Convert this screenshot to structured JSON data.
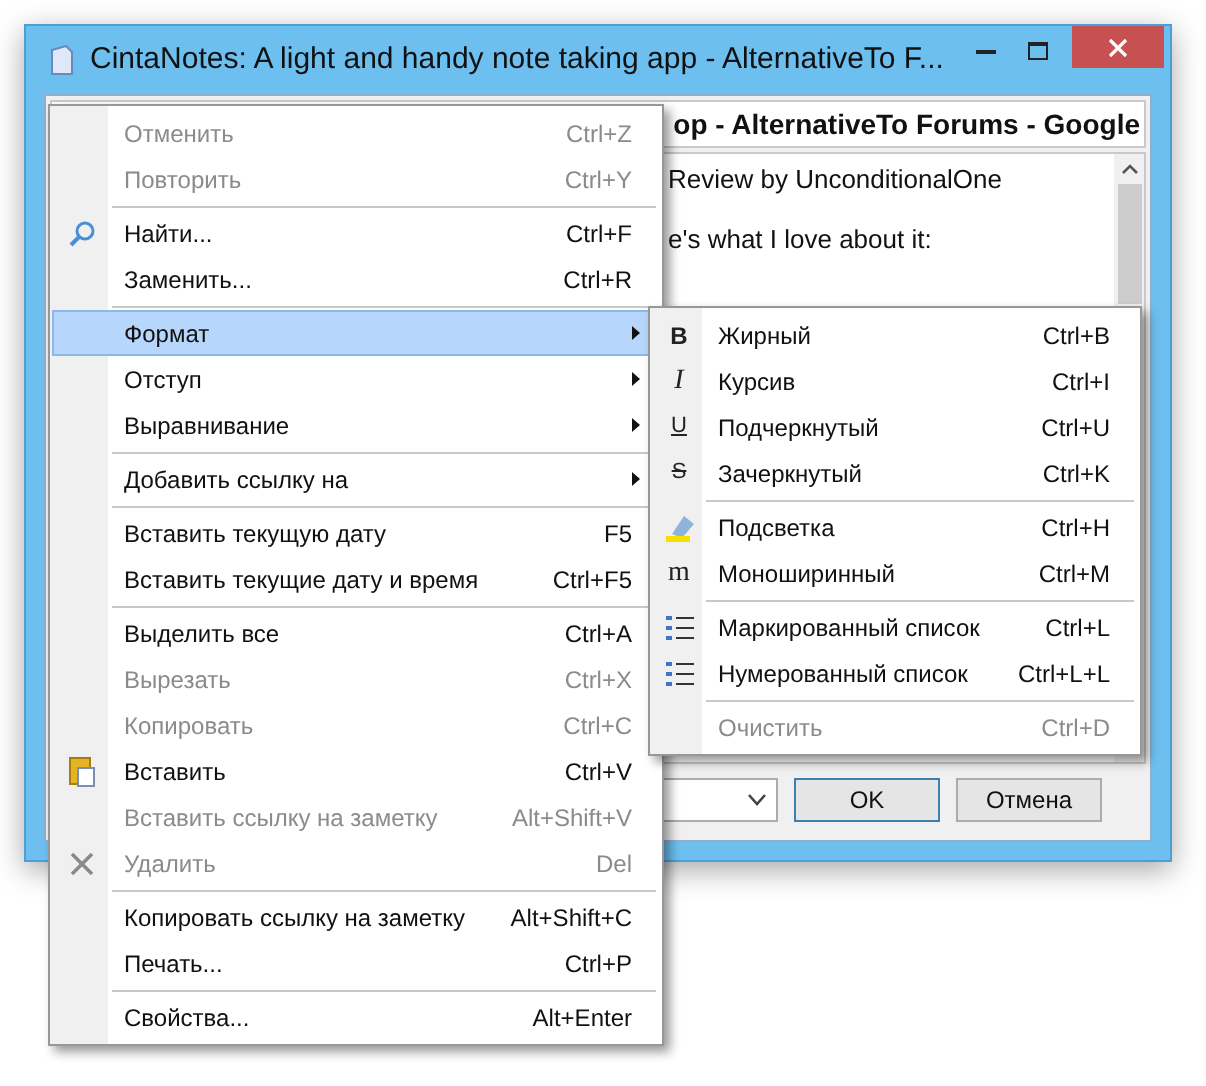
{
  "window": {
    "title": "CintaNotes: A light and handy note taking app - AlternativeTo F..."
  },
  "note": {
    "heading": "op - AlternativeTo Forums - Google",
    "lines": [
      "Review by UnconditionalOne",
      "e's what I love about it:"
    ]
  },
  "buttons": [
    {
      "label": "OK",
      "default": true
    },
    {
      "label": "Отмена",
      "default": false
    }
  ],
  "context_menu": {
    "items": [
      {
        "kind": "item",
        "label": "Отменить",
        "shortcut": "Ctrl+Z",
        "disabled": true
      },
      {
        "kind": "item",
        "label": "Повторить",
        "shortcut": "Ctrl+Y",
        "disabled": true
      },
      {
        "kind": "separator"
      },
      {
        "kind": "item",
        "label": "Найти...",
        "shortcut": "Ctrl+F",
        "disabled": false
      },
      {
        "kind": "item",
        "label": "Заменить...",
        "shortcut": "Ctrl+R",
        "disabled": false
      },
      {
        "kind": "separator"
      },
      {
        "kind": "submenu",
        "label": "Формат",
        "disabled": false,
        "selected": true
      },
      {
        "kind": "submenu",
        "label": "Отступ",
        "disabled": false,
        "selected": false
      },
      {
        "kind": "submenu",
        "label": "Выравнивание",
        "disabled": false,
        "selected": false
      },
      {
        "kind": "separator"
      },
      {
        "kind": "submenu",
        "label": "Добавить ссылку на",
        "disabled": false,
        "selected": false
      },
      {
        "kind": "separator"
      },
      {
        "kind": "item",
        "label": "Вставить текущую дату",
        "shortcut": "F5",
        "disabled": false
      },
      {
        "kind": "item",
        "label": "Вставить текущие дату и время",
        "shortcut": "Ctrl+F5",
        "disabled": false
      },
      {
        "kind": "separator"
      },
      {
        "kind": "item",
        "label": "Выделить все",
        "shortcut": "Ctrl+A",
        "disabled": false
      },
      {
        "kind": "item",
        "label": "Вырезать",
        "shortcut": "Ctrl+X",
        "disabled": true
      },
      {
        "kind": "item",
        "label": "Копировать",
        "shortcut": "Ctrl+C",
        "disabled": true
      },
      {
        "kind": "item",
        "label": "Вставить",
        "shortcut": "Ctrl+V",
        "disabled": false
      },
      {
        "kind": "item",
        "label": "Вставить ссылку на заметку",
        "shortcut": "Alt+Shift+V",
        "disabled": true
      },
      {
        "kind": "item",
        "label": "Удалить",
        "shortcut": "Del",
        "disabled": true
      },
      {
        "kind": "separator"
      },
      {
        "kind": "item",
        "label": "Копировать ссылку на заметку",
        "shortcut": "Alt+Shift+C",
        "disabled": false
      },
      {
        "kind": "item",
        "label": "Печать...",
        "shortcut": "Ctrl+P",
        "disabled": false
      },
      {
        "kind": "separator"
      },
      {
        "kind": "item",
        "label": "Свойства...",
        "shortcut": "Alt+Enter",
        "disabled": false
      }
    ]
  },
  "format_submenu": {
    "items": [
      {
        "kind": "item",
        "label": "Жирный",
        "shortcut": "Ctrl+B",
        "disabled": false,
        "glyph": "B"
      },
      {
        "kind": "item",
        "label": "Курсив",
        "shortcut": "Ctrl+I",
        "disabled": false,
        "glyph": "I"
      },
      {
        "kind": "item",
        "label": "Подчеркнутый",
        "shortcut": "Ctrl+U",
        "disabled": false,
        "glyph": "U"
      },
      {
        "kind": "item",
        "label": "Зачеркнутый",
        "shortcut": "Ctrl+K",
        "disabled": false,
        "glyph": "S"
      },
      {
        "kind": "separator"
      },
      {
        "kind": "item",
        "label": "Подсветка",
        "shortcut": "Ctrl+H",
        "disabled": false
      },
      {
        "kind": "item",
        "label": "Моноширинный",
        "shortcut": "Ctrl+M",
        "disabled": false,
        "glyph": "m"
      },
      {
        "kind": "separator"
      },
      {
        "kind": "item",
        "label": "Маркированный список",
        "shortcut": "Ctrl+L",
        "disabled": false
      },
      {
        "kind": "item",
        "label": "Нумерованный список",
        "shortcut": "Ctrl+L+L",
        "disabled": false
      },
      {
        "kind": "separator"
      },
      {
        "kind": "item",
        "label": "Очистить",
        "shortcut": "Ctrl+D",
        "disabled": true
      }
    ]
  }
}
